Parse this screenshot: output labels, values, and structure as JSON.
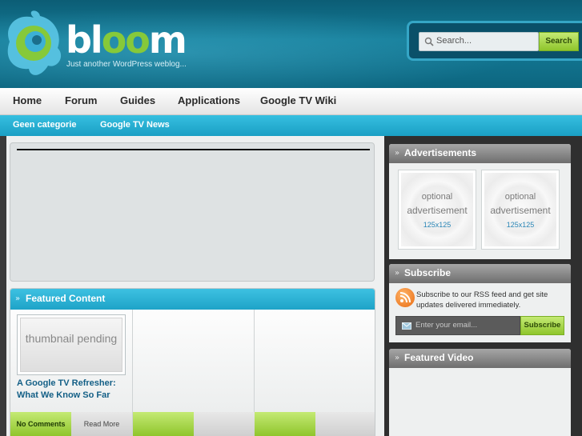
{
  "header": {
    "logo_prefix": "bl",
    "logo_oo": "oo",
    "logo_suffix": "m",
    "tagline": "Just another WordPress weblog...",
    "search_placeholder": "Search...",
    "search_button": "Search"
  },
  "main_nav": [
    "Home",
    "Forum",
    "Guides",
    "Applications",
    "Google TV Wiki"
  ],
  "sub_nav": [
    "Geen categorie",
    "Google TV News"
  ],
  "featured": {
    "title": "Featured Content",
    "thumbnail_text": "thumbnail pending",
    "post_title": "A Google TV Refresher: What We Know So Far",
    "comments_label": "No Comments",
    "read_more_label": "Read More"
  },
  "sidebar": {
    "ads": {
      "title": "Advertisements",
      "ad_line1": "optional",
      "ad_line2": "advertisement",
      "ad_size": "125x125"
    },
    "subscribe": {
      "title": "Subscribe",
      "text": "Subscribe to our RSS feed and get site updates delivered immediately.",
      "email_placeholder": "Enter your email...",
      "button": "Subscribe"
    },
    "video": {
      "title": "Featured Video"
    }
  },
  "colors": {
    "header_teal": "#147c98",
    "accent_cyan": "#1ea3c8",
    "accent_green": "#8fc52c",
    "title_blue": "#135f86"
  }
}
